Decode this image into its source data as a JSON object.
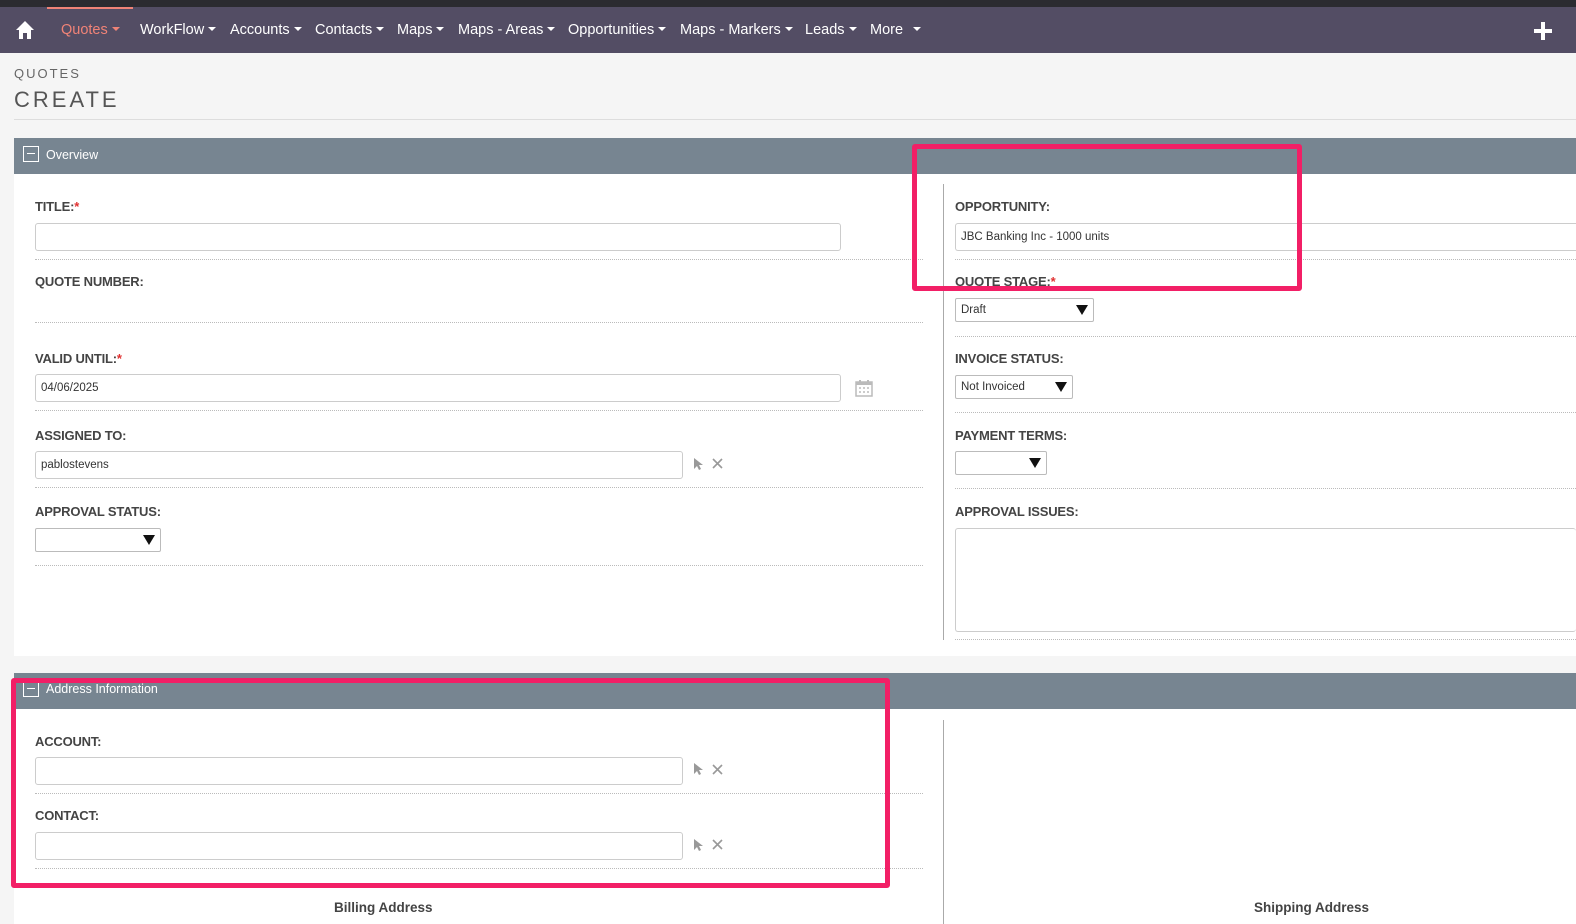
{
  "nav": {
    "items": [
      {
        "label": "Quotes",
        "active": true
      },
      {
        "label": "WorkFlow"
      },
      {
        "label": "Accounts"
      },
      {
        "label": "Contacts"
      },
      {
        "label": "Maps"
      },
      {
        "label": "Maps - Areas"
      },
      {
        "label": "Opportunities"
      },
      {
        "label": "Maps - Markers"
      },
      {
        "label": "Leads"
      },
      {
        "label": "More"
      }
    ],
    "home_icon": "home-icon",
    "add_icon": "plus-icon"
  },
  "header": {
    "module": "QUOTES",
    "view": "CREATE"
  },
  "overview": {
    "panel_title": "Overview",
    "title_label": "TITLE:",
    "title_value": "",
    "opportunity_label": "OPPORTUNITY:",
    "opportunity_value": "JBC Banking Inc - 1000 units",
    "quote_number_label": "QUOTE NUMBER:",
    "quote_stage_label": "QUOTE STAGE:",
    "quote_stage_value": "Draft",
    "valid_until_label": "VALID UNTIL:",
    "valid_until_value": "04/06/2025",
    "invoice_status_label": "INVOICE STATUS:",
    "invoice_status_value": "Not Invoiced",
    "assigned_to_label": "ASSIGNED TO:",
    "assigned_to_value": "pablostevens",
    "payment_terms_label": "PAYMENT TERMS:",
    "payment_terms_value": "",
    "approval_status_label": "APPROVAL STATUS:",
    "approval_status_value": "",
    "approval_issues_label": "APPROVAL ISSUES:",
    "required_mark": "*"
  },
  "address": {
    "panel_title": "Address Information",
    "account_label": "ACCOUNT:",
    "account_value": "",
    "contact_label": "CONTACT:",
    "contact_value": "",
    "billing_heading": "Billing Address",
    "shipping_heading": "Shipping Address"
  },
  "colors": {
    "highlight": "#f21f66",
    "navbar": "#534d64",
    "active_nav": "#f08377",
    "panel_header": "#778591"
  }
}
